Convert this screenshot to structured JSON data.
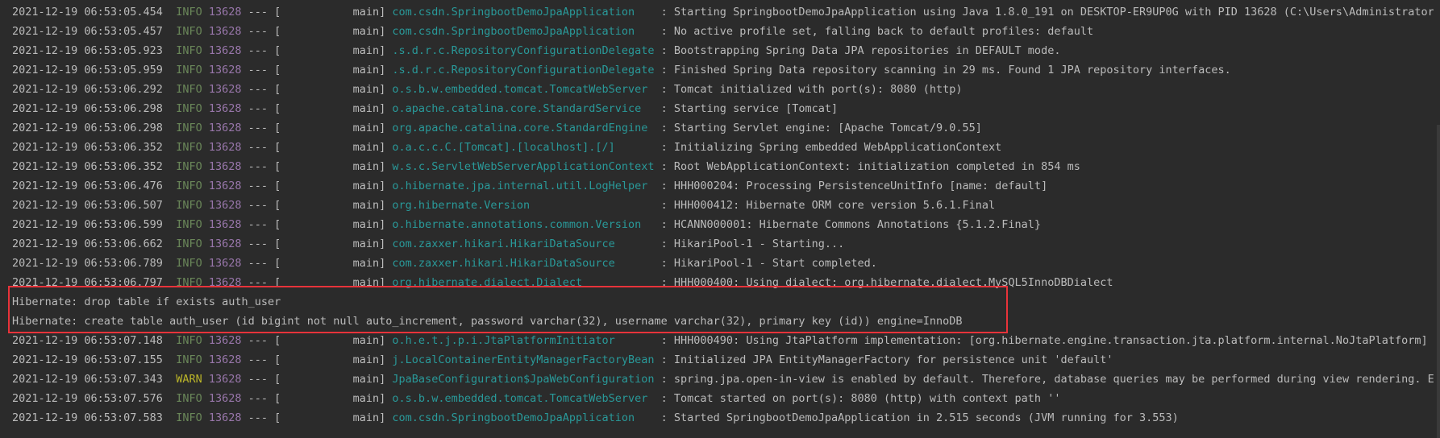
{
  "colors": {
    "background": "#2b2b2b",
    "text": "#bbbbbb",
    "info": "#6a8759",
    "warn": "#bbb529",
    "pid": "#9876aa",
    "logger": "#299999",
    "highlight_border": "#e8333a"
  },
  "log_lines": [
    {
      "type": "log",
      "ts": "2021-12-19 06:53:05.454",
      "level": "INFO",
      "pid": "13628",
      "thread": " --- [           main] ",
      "logger": "com.csdn.SpringbootDemoJpaApplication   ",
      "msg": " : Starting SpringbootDemoJpaApplication using Java 1.8.0_191 on DESKTOP-ER9UP0G with PID 13628 (C:\\Users\\Administrator\\Desk"
    },
    {
      "type": "log",
      "ts": "2021-12-19 06:53:05.457",
      "level": "INFO",
      "pid": "13628",
      "thread": " --- [           main] ",
      "logger": "com.csdn.SpringbootDemoJpaApplication   ",
      "msg": " : No active profile set, falling back to default profiles: default"
    },
    {
      "type": "log",
      "ts": "2021-12-19 06:53:05.923",
      "level": "INFO",
      "pid": "13628",
      "thread": " --- [           main] ",
      "logger": ".s.d.r.c.RepositoryConfigurationDelegate",
      "msg": " : Bootstrapping Spring Data JPA repositories in DEFAULT mode."
    },
    {
      "type": "log",
      "ts": "2021-12-19 06:53:05.959",
      "level": "INFO",
      "pid": "13628",
      "thread": " --- [           main] ",
      "logger": ".s.d.r.c.RepositoryConfigurationDelegate",
      "msg": " : Finished Spring Data repository scanning in 29 ms. Found 1 JPA repository interfaces."
    },
    {
      "type": "log",
      "ts": "2021-12-19 06:53:06.292",
      "level": "INFO",
      "pid": "13628",
      "thread": " --- [           main] ",
      "logger": "o.s.b.w.embedded.tomcat.TomcatWebServer ",
      "msg": " : Tomcat initialized with port(s): 8080 (http)"
    },
    {
      "type": "log",
      "ts": "2021-12-19 06:53:06.298",
      "level": "INFO",
      "pid": "13628",
      "thread": " --- [           main] ",
      "logger": "o.apache.catalina.core.StandardService  ",
      "msg": " : Starting service [Tomcat]"
    },
    {
      "type": "log",
      "ts": "2021-12-19 06:53:06.298",
      "level": "INFO",
      "pid": "13628",
      "thread": " --- [           main] ",
      "logger": "org.apache.catalina.core.StandardEngine ",
      "msg": " : Starting Servlet engine: [Apache Tomcat/9.0.55]"
    },
    {
      "type": "log",
      "ts": "2021-12-19 06:53:06.352",
      "level": "INFO",
      "pid": "13628",
      "thread": " --- [           main] ",
      "logger": "o.a.c.c.C.[Tomcat].[localhost].[/]      ",
      "msg": " : Initializing Spring embedded WebApplicationContext"
    },
    {
      "type": "log",
      "ts": "2021-12-19 06:53:06.352",
      "level": "INFO",
      "pid": "13628",
      "thread": " --- [           main] ",
      "logger": "w.s.c.ServletWebServerApplicationContext",
      "msg": " : Root WebApplicationContext: initialization completed in 854 ms"
    },
    {
      "type": "log",
      "ts": "2021-12-19 06:53:06.476",
      "level": "INFO",
      "pid": "13628",
      "thread": " --- [           main] ",
      "logger": "o.hibernate.jpa.internal.util.LogHelper ",
      "msg": " : HHH000204: Processing PersistenceUnitInfo [name: default]"
    },
    {
      "type": "log",
      "ts": "2021-12-19 06:53:06.507",
      "level": "INFO",
      "pid": "13628",
      "thread": " --- [           main] ",
      "logger": "org.hibernate.Version                   ",
      "msg": " : HHH000412: Hibernate ORM core version 5.6.1.Final"
    },
    {
      "type": "log",
      "ts": "2021-12-19 06:53:06.599",
      "level": "INFO",
      "pid": "13628",
      "thread": " --- [           main] ",
      "logger": "o.hibernate.annotations.common.Version  ",
      "msg": " : HCANN000001: Hibernate Commons Annotations {5.1.2.Final}"
    },
    {
      "type": "log",
      "ts": "2021-12-19 06:53:06.662",
      "level": "INFO",
      "pid": "13628",
      "thread": " --- [           main] ",
      "logger": "com.zaxxer.hikari.HikariDataSource      ",
      "msg": " : HikariPool-1 - Starting..."
    },
    {
      "type": "log",
      "ts": "2021-12-19 06:53:06.789",
      "level": "INFO",
      "pid": "13628",
      "thread": " --- [           main] ",
      "logger": "com.zaxxer.hikari.HikariDataSource      ",
      "msg": " : HikariPool-1 - Start completed."
    },
    {
      "type": "log",
      "ts": "2021-12-19 06:53:06.797",
      "level": "INFO",
      "pid": "13628",
      "thread": " --- [           main] ",
      "logger": "org.hibernate.dialect.Dialect           ",
      "msg": " : HHH000400: Using dialect: org.hibernate.dialect.MySQL5InnoDBDialect"
    },
    {
      "type": "plain",
      "text": "Hibernate: drop table if exists auth_user"
    },
    {
      "type": "plain",
      "text": "Hibernate: create table auth_user (id bigint not null auto_increment, password varchar(32), username varchar(32), primary key (id)) engine=InnoDB"
    },
    {
      "type": "log",
      "ts": "2021-12-19 06:53:07.148",
      "level": "INFO",
      "pid": "13628",
      "thread": " --- [           main] ",
      "logger": "o.h.e.t.j.p.i.JtaPlatformInitiator      ",
      "msg": " : HHH000490: Using JtaPlatform implementation: [org.hibernate.engine.transaction.jta.platform.internal.NoJtaPlatform]"
    },
    {
      "type": "log",
      "ts": "2021-12-19 06:53:07.155",
      "level": "INFO",
      "pid": "13628",
      "thread": " --- [           main] ",
      "logger": "j.LocalContainerEntityManagerFactoryBean",
      "msg": " : Initialized JPA EntityManagerFactory for persistence unit 'default'"
    },
    {
      "type": "log",
      "ts": "2021-12-19 06:53:07.343",
      "level": "WARN",
      "pid": "13628",
      "thread": " --- [           main] ",
      "logger": "JpaBaseConfiguration$JpaWebConfiguration",
      "msg": " : spring.jpa.open-in-view is enabled by default. Therefore, database queries may be performed during view rendering. Explic"
    },
    {
      "type": "log",
      "ts": "2021-12-19 06:53:07.576",
      "level": "INFO",
      "pid": "13628",
      "thread": " --- [           main] ",
      "logger": "o.s.b.w.embedded.tomcat.TomcatWebServer ",
      "msg": " : Tomcat started on port(s): 8080 (http) with context path ''"
    },
    {
      "type": "log",
      "ts": "2021-12-19 06:53:07.583",
      "level": "INFO",
      "pid": "13628",
      "thread": " --- [           main] ",
      "logger": "com.csdn.SpringbootDemoJpaApplication   ",
      "msg": " : Started SpringbootDemoJpaApplication in 2.515 seconds (JVM running for 3.553)"
    }
  ]
}
